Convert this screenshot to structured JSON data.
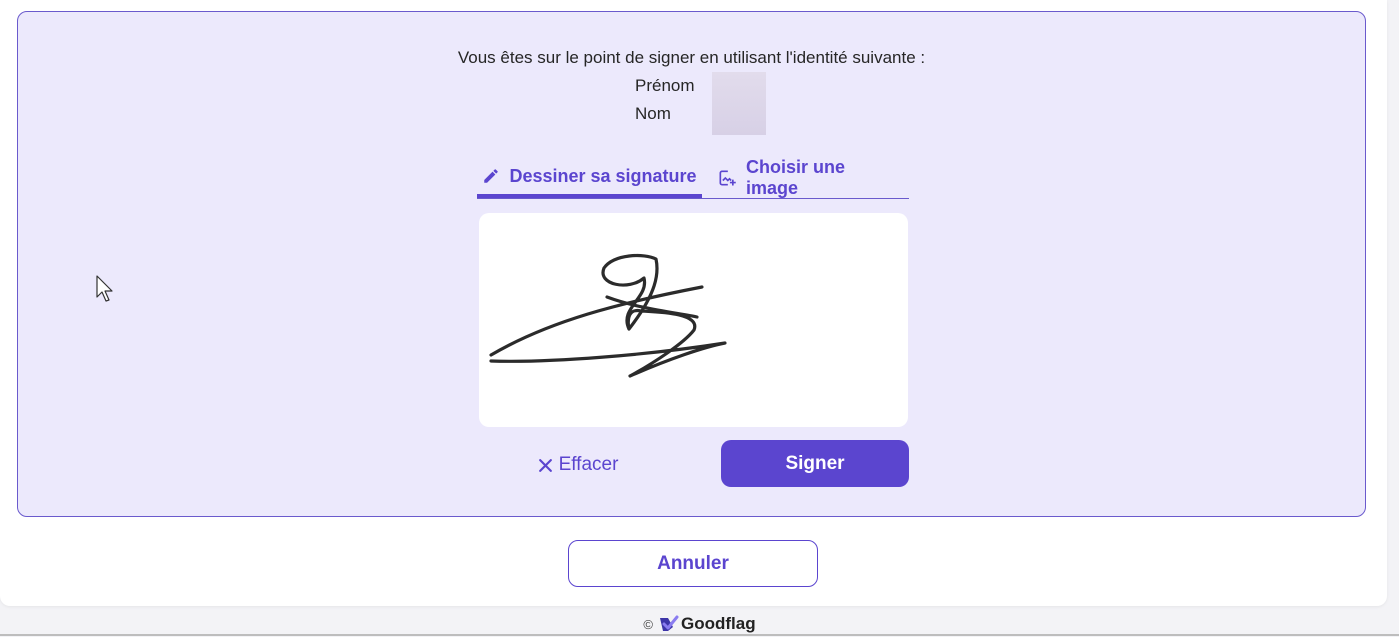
{
  "identity": {
    "intro": "Vous êtes sur le point de signer en utilisant l'identité suivante :",
    "first_name_label": "Prénom",
    "last_name_label": "Nom"
  },
  "tabs": [
    {
      "label": "Dessiner sa signature",
      "icon": "pencil-icon",
      "active": true
    },
    {
      "label": "Choisir une image",
      "icon": "add-image-icon",
      "active": false
    }
  ],
  "actions": {
    "clear_label": "Effacer",
    "sign_label": "Signer",
    "cancel_label": "Annuler"
  },
  "footer": {
    "copyright": "©",
    "brand": "Goodflag"
  },
  "colors": {
    "accent": "#5b45cf",
    "panel_bg": "#ece9fc",
    "panel_border": "#6a5acd",
    "ink": "#2b2b2b"
  }
}
